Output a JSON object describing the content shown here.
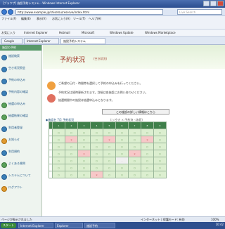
{
  "window": {
    "title": "[ブラウザ] 施設予約システム - Windows Internet Explorer"
  },
  "address": {
    "url": "http://www.example.jp/shisetsu/reserve/index.html",
    "search_placeholder": "Live Search"
  },
  "menubar": {
    "items": [
      "ファイル(F)",
      "編集(E)",
      "表示(V)",
      "お気に入り(A)",
      "ツール(T)",
      "ヘルプ(H)"
    ]
  },
  "favbar": {
    "items": [
      "お気に入り",
      "Internet Explorer",
      "Hotmail",
      "Microsoft",
      "Windows Update",
      "Windows Marketplace"
    ]
  },
  "tabs": {
    "items": [
      "Google",
      "Internet Explorer",
      "施設予約システム"
    ]
  },
  "sidebar": {
    "header": "施設の予約",
    "items": [
      "施設検索",
      "空き状況照会",
      "予約の申込み",
      "予約内容の確認",
      "抽選の申込み",
      "抽選結果の確認",
      "利用者登録",
      "お知らせ",
      "利用規約",
      "よくある質問",
      "システムについて",
      "ログアウト"
    ]
  },
  "main": {
    "title": "予約状況",
    "subtitle": "(空き状況)",
    "notices": [
      "ご希望の日付・時間帯を選択して予約の申込みを行ってください。",
      "予約状況は随時更新されます。詳細は各施設にお問い合わせください。",
      "抽選期間中の施設は抽選申込みとなります。"
    ],
    "link_button": "この施設の詳しい情報はこちら",
    "schedule_title": "◆施設名 7月 予約状況",
    "schedule_hint": "(○:空き ×:予約済 -:休館)",
    "grid": {
      "days": [
        "1",
        "2",
        "3",
        "4",
        "5",
        "6",
        "7",
        "8",
        "9"
      ],
      "rows": [
        {
          "cells": [
            "○",
            "○",
            "○",
            "○",
            "○",
            "○",
            "○",
            "○",
            "○"
          ]
        },
        {
          "cells": [
            "○",
            "×",
            "○",
            "○",
            "×",
            "○",
            "○",
            "×",
            "○"
          ]
        },
        {
          "cells": [
            "○",
            "○",
            "○",
            "○",
            "○",
            "○",
            "○",
            "○",
            "○"
          ]
        },
        {
          "cells": [
            "○",
            "○",
            "×",
            "○",
            "○",
            "○",
            "×",
            "○",
            "○"
          ]
        },
        {
          "cells": [
            "○",
            "○",
            "○",
            "○",
            "○",
            "-",
            "○",
            "○",
            "○"
          ]
        },
        {
          "cells": [
            "○",
            "○",
            "○",
            "○",
            "○",
            "○",
            "○",
            "○",
            "○"
          ]
        },
        {
          "cells": [
            "○",
            "○",
            "○",
            "×",
            "○",
            "○",
            "○",
            "○",
            "○"
          ]
        }
      ]
    }
  },
  "statusbar": {
    "left": "ページが表示されました",
    "right": "インターネット | 保護モード: 有効",
    "zoom": "100%"
  },
  "taskbar": {
    "start": "スタート",
    "items": [
      "Internet Explorer",
      "Explorer",
      "施設予約"
    ],
    "clock": "10:42"
  }
}
